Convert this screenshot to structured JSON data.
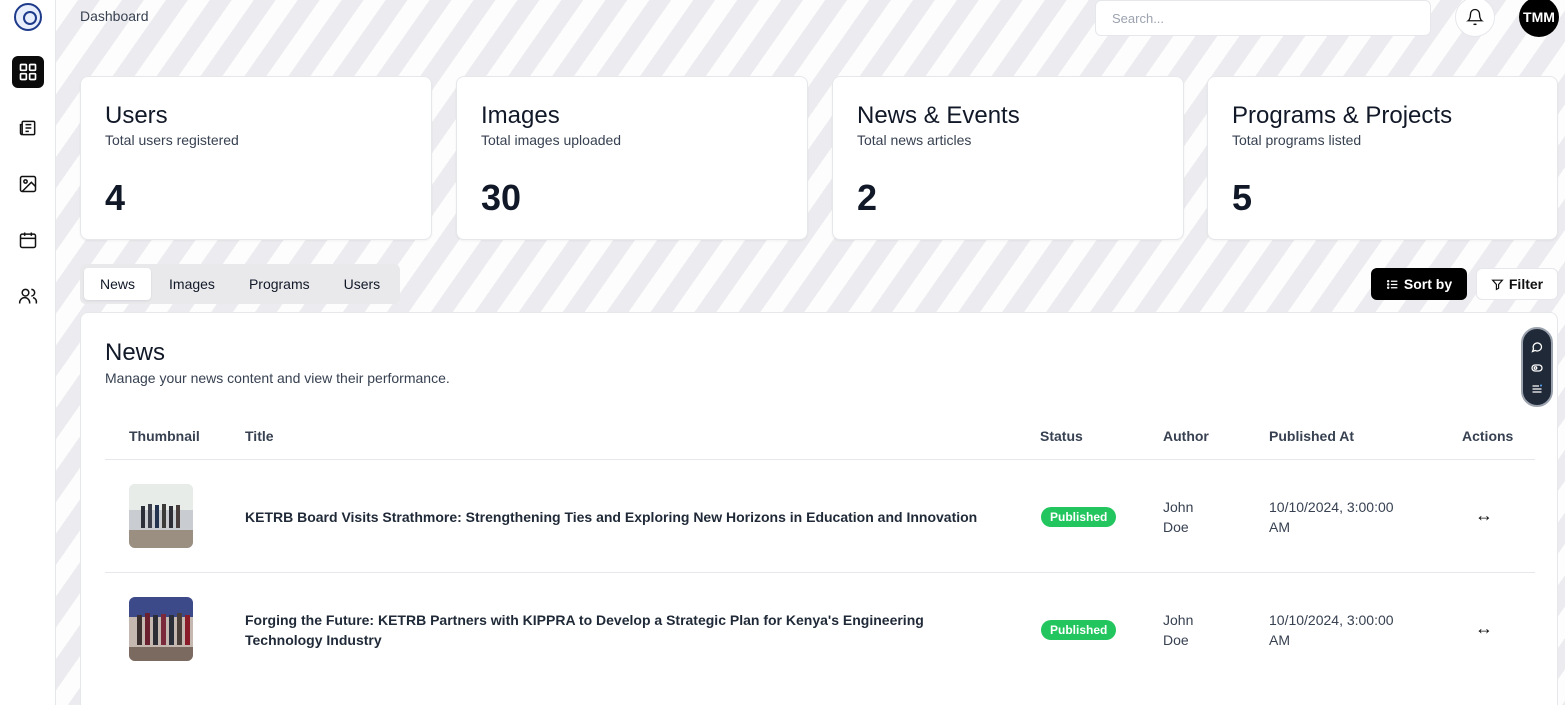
{
  "header": {
    "title": "Dashboard",
    "search_placeholder": "Search...",
    "avatar_initials": "TMM"
  },
  "sidebar": {
    "items": [
      {
        "icon": "dashboard-grid-icon",
        "active": true
      },
      {
        "icon": "newspaper-icon",
        "active": false
      },
      {
        "icon": "image-icon",
        "active": false
      },
      {
        "icon": "calendar-icon",
        "active": false
      },
      {
        "icon": "users-icon",
        "active": false
      }
    ]
  },
  "stats": [
    {
      "title": "Users",
      "subtitle": "Total users registered",
      "value": "4"
    },
    {
      "title": "Images",
      "subtitle": "Total images uploaded",
      "value": "30"
    },
    {
      "title": "News & Events",
      "subtitle": "Total news articles",
      "value": "2"
    },
    {
      "title": "Programs & Projects",
      "subtitle": "Total programs listed",
      "value": "5"
    }
  ],
  "tabs": [
    {
      "label": "News",
      "active": true
    },
    {
      "label": "Images",
      "active": false
    },
    {
      "label": "Programs",
      "active": false
    },
    {
      "label": "Users",
      "active": false
    }
  ],
  "toolbar": {
    "sort_label": "Sort by",
    "filter_label": "Filter"
  },
  "news": {
    "title": "News",
    "subtitle": "Manage your news content and view their performance.",
    "columns": [
      "Thumbnail",
      "Title",
      "Status",
      "Author",
      "Published At",
      "Actions"
    ],
    "rows": [
      {
        "title": "KETRB Board Visits Strathmore: Strengthening Ties and Exploring New Horizons in Education and Innovation",
        "status": "Published",
        "author_line1": "John",
        "author_line2": "Doe",
        "published_line1": "10/10/2024, 3:00:00",
        "published_line2": "AM",
        "action": "↔"
      },
      {
        "title": "Forging the Future: KETRB Partners with KIPPRA to Develop a Strategic Plan for Kenya's Engineering Technology Industry",
        "status": "Published",
        "author_line1": "John",
        "author_line2": "Doe",
        "published_line1": "10/10/2024, 3:00:00",
        "published_line2": "AM",
        "action": "↔"
      }
    ]
  },
  "colors": {
    "accent": "#000000",
    "published": "#22c55e"
  }
}
